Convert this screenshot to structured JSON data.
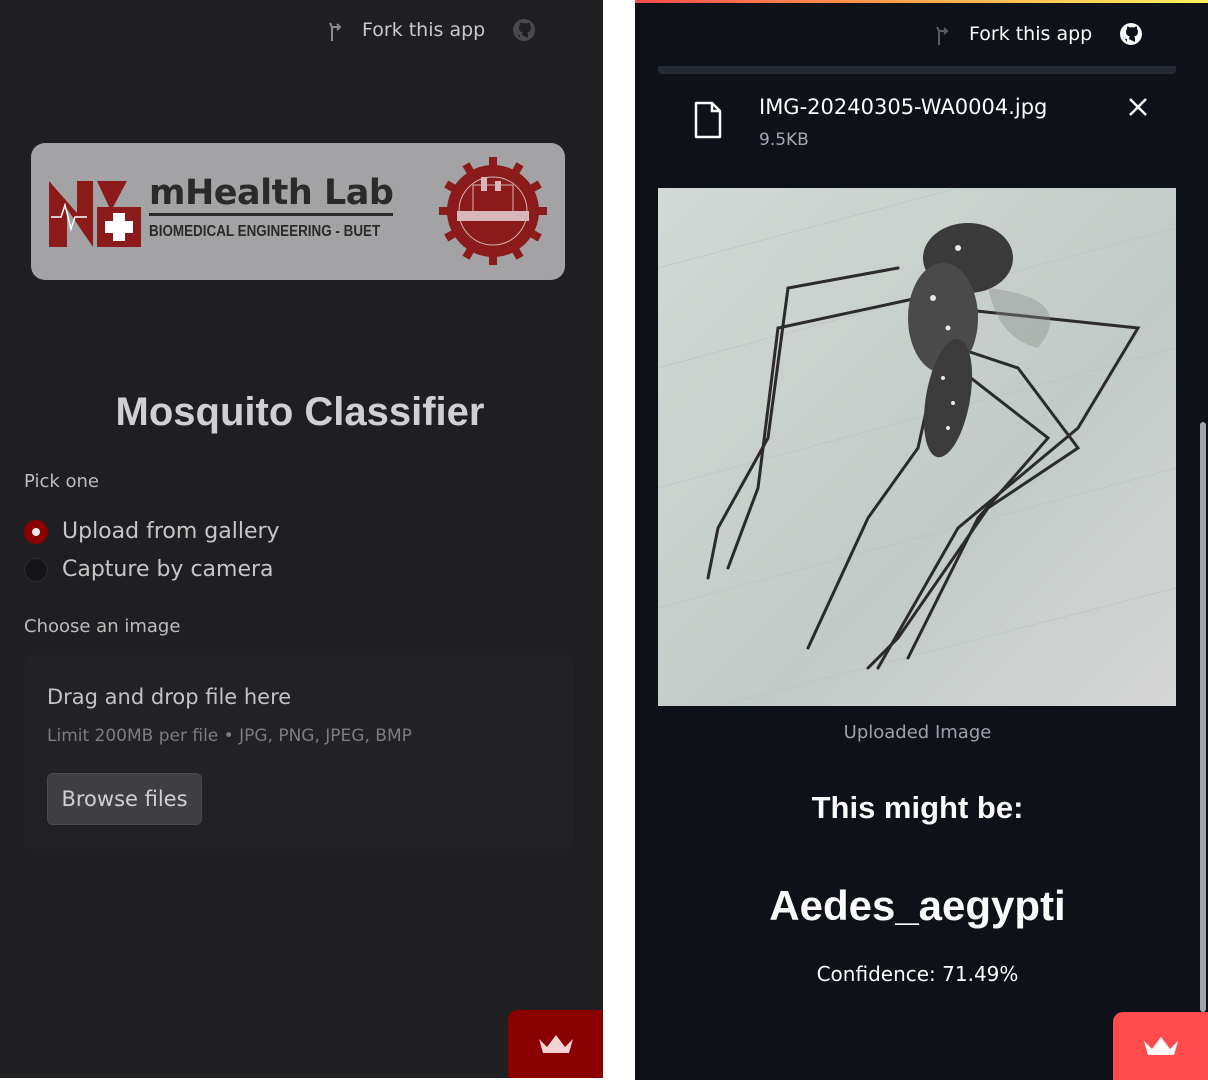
{
  "left_screen": {
    "header": {
      "fork_label": "Fork this app",
      "fork_icon": "fork-icon",
      "github_icon": "github-icon"
    },
    "logo": {
      "name": "mHealth Lab",
      "subtitle": "BIOMEDICAL ENGINEERING - BUET"
    },
    "title": "Mosquito Classifier",
    "picker": {
      "label": "Pick one",
      "options": [
        {
          "label": "Upload from gallery",
          "selected": true
        },
        {
          "label": "Capture by camera",
          "selected": false
        }
      ]
    },
    "uploader": {
      "label": "Choose an image",
      "dropzone_title": "Drag and drop file here",
      "limit_text": "Limit 200MB per file • JPG, PNG, JPEG, BMP",
      "browse_label": "Browse files"
    },
    "badge_icon": "crown-icon",
    "accent_color": "#8b0000"
  },
  "right_screen": {
    "header": {
      "fork_label": "Fork this app",
      "fork_icon": "fork-icon",
      "github_icon": "github-icon"
    },
    "file": {
      "name": "IMG-20240305-WA0004.jpg",
      "size": "9.5KB",
      "file_icon": "file-icon",
      "remove_icon": "close-icon"
    },
    "image_caption": "Uploaded Image",
    "prediction_heading": "This might be:",
    "prediction": "Aedes_aegypti",
    "confidence_text": "Confidence: 71.49%",
    "badge_icon": "crown-icon",
    "accent_color": "#ff4b4b"
  }
}
